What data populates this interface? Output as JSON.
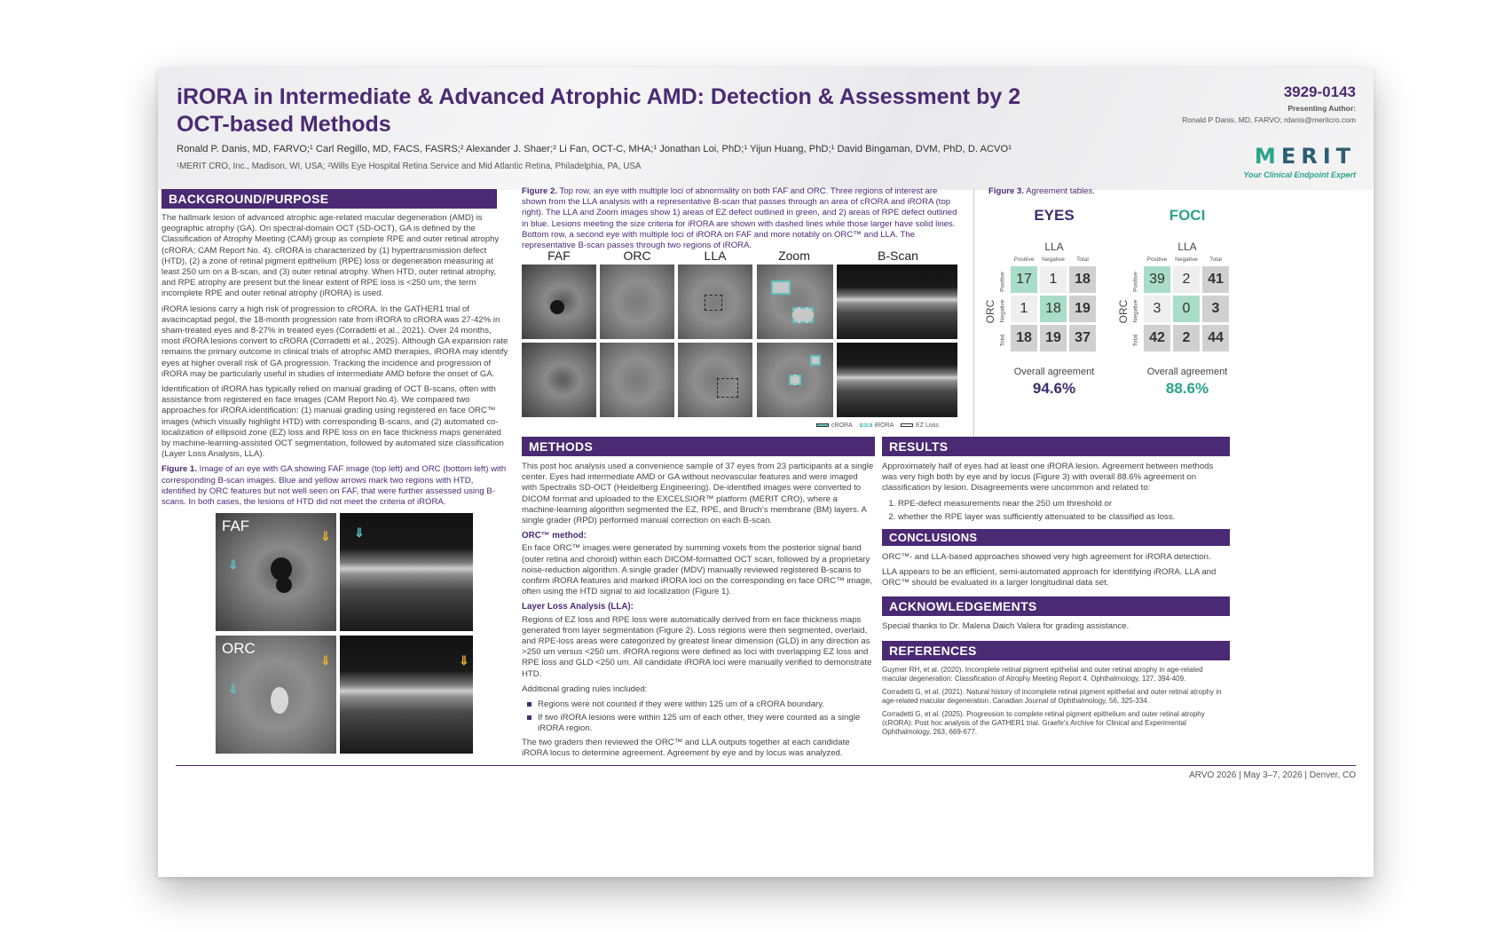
{
  "header": {
    "title": "iRORA in Intermediate & Advanced Atrophic AMD: Detection & Assessment by 2 OCT-based Methods",
    "authors": "Ronald P. Danis, MD, FARVO;¹ Carl Regillo, MD, FACS, FASRS;² Alexander J. Shaer;² Li Fan, OCT-C, MHA;¹ Jonathan Loi, PhD;¹ Yijun Huang, PhD;¹ David Bingaman, DVM, PhD, D. ACVO¹",
    "affiliations": "¹MERIT CRO, Inc., Madison, WI, USA; ²Wills Eye Hospital Retina Service and Mid Atlantic Retina, Philadelphia, PA, USA",
    "poster_id": "3929-0143",
    "presenting_label": "Presenting Author:",
    "presenting_name": "Ronald P Danis, MD, FARVO; rdanis@meritcro.com",
    "logo_text": "MERIT",
    "logo_tagline": "Your Clinical Endpoint Expert"
  },
  "background": {
    "heading": "BACKGROUND/PURPOSE",
    "p1": "The hallmark lesion of advanced atrophic age-related macular degeneration (AMD) is geographic atrophy (GA). On spectral-domain OCT (SD-OCT), GA is defined by the Classification of Atrophy Meeting (CAM) group as complete RPE and outer retinal atrophy (cRORA; CAM Report No. 4). cRORA is characterized by (1) hypertransmission defect (HTD), (2) a zone of retinal pigment epithelium (RPE) loss or degeneration measuring at least 250 um on a B-scan, and (3) outer retinal atrophy. When HTD, outer retinal atrophy, and RPE atrophy are present but the linear extent of RPE loss is <250 um, the term incomplete RPE and outer retinal atrophy (iRORA) is used.",
    "p2": "iRORA lesions carry a high risk of progression to cRORA. In the GATHER1 trial of avacincaptad pegol, the 18-month progression rate from iRORA to cRORA was 27-42% in sham-treated eyes and 8-27% in treated eyes (Corradetti et al., 2021). Over 24 months, most iRORA lesions convert to cRORA (Corradetti et al., 2025). Although GA expansion rate remains the primary outcome in clinical trials of atrophic AMD therapies, iRORA may identify eyes at higher overall risk of GA progression. Tracking the incidence and progression of iRORA may be particularly useful in studies of intermediate AMD before the onset of GA.",
    "p3": "Identification of iRORA has typically relied on manual grading of OCT B-scans, often with assistance from registered en face images (CAM Report No.4). We compared two approaches for iRORA identification: (1) manual grading using registered en face ORC™ images (which visually highlight HTD) with corresponding B-scans, and (2) automated co-localization of ellipsoid zone (EZ) loss and RPE loss on en face thickness maps generated by machine-learning-assisted OCT segmentation, followed by automated size classification (Layer Loss Analysis, LLA).",
    "fig1_label": "Figure 1.",
    "fig1_caption": " Image of an eye with GA showing FAF image (top left) and ORC (bottom left) with corresponding B-scan images. Blue and yellow arrows mark two regions with HTD, identified by ORC features but not well seen on FAF, that were further assessed using B-scans. In both cases, the lesions of HTD did not meet the criteria of iRORA.",
    "fig1_img1_label": "FAF",
    "fig1_img2_label": "ORC"
  },
  "figure2": {
    "label": "Figure 2.",
    "caption": " Top row, an eye with multiple loci of abnormality on both FAF and ORC.  Three regions of interest are shown from the LLA analysis with a representative B-scan that passes through an area of cRORA and iRORA (top right). The LLA and Zoom images show 1) areas of EZ defect outlined in green, and 2) areas of RPE defect outlined in blue. Lesions meeting the size criteria for iRORA are shown with dashed lines while those larger have solid lines. Bottom row, a second eye with multiple loci of iRORA on FAF and more notably on ORC™ and LLA. The representative B-scan passes through two regions of iRORA.",
    "columns": [
      "FAF",
      "ORC",
      "LLA",
      "Zoom",
      "B-Scan"
    ],
    "legend": [
      "cRORA",
      "iRORA",
      "EZ Loss"
    ]
  },
  "figure3": {
    "label": "Figure 3.",
    "caption": " Agreement tables.",
    "row_labels": [
      "Positive",
      "Negative",
      "Total"
    ],
    "col_labels": [
      "Positive",
      "Negative",
      "Total"
    ],
    "axis_top": "LLA",
    "axis_side": "ORC",
    "overall_label": "Overall agreement",
    "eyes": {
      "title": "EYES",
      "color": "#3b2e6e",
      "cells": [
        [
          "17",
          "1",
          "18"
        ],
        [
          "1",
          "18",
          "19"
        ],
        [
          "18",
          "19",
          "37"
        ]
      ],
      "agreement": "94.6%"
    },
    "foci": {
      "title": "FOCI",
      "color": "#2aa48a",
      "cells": [
        [
          "39",
          "2",
          "41"
        ],
        [
          "3",
          "0",
          "3"
        ],
        [
          "42",
          "2",
          "44"
        ]
      ],
      "agreement": "88.6%"
    }
  },
  "methods": {
    "heading": "METHODS",
    "p1": "This post hoc analysis used a convenience sample of 37 eyes from 23 participants at a single center. Eyes had intermediate AMD or GA without neovascular features and were imaged with Spectralis SD-OCT (Heidelberg Engineering). De-identified images were converted to DICOM format and uploaded to the EXCELSIOR™ platform (MERIT CRO), where a machine-learning algorithm segmented the EZ, RPE, and Bruch's membrane (BM) layers. A single grader (RPD) performed manual correction on each B-scan.",
    "orc_heading": "ORC™ method:",
    "orc_text": "En face ORC™ images were generated by summing voxels from the posterior signal band (outer retina and choroid) within each DICOM-formatted OCT scan, followed by a proprietary noise-reduction algorithm. A single grader (MDV) manually reviewed registered B-scans to confirm iRORA features and marked iRORA loci on the corresponding en face ORC™ image, often using the HTD signal to aid localization (Figure 1).",
    "lla_heading": "Layer Loss Analysis (LLA):",
    "lla_text": "Regions of EZ loss and RPE loss were automatically derived from en face thickness maps generated from layer segmentation (Figure 2). Loss regions were then segmented, overlaid, and RPE-loss areas were categorized by greatest linear dimension (GLD) in any direction as >250 um versus <250 um. iRORA regions were defined as loci with overlapping EZ loss and RPE loss and GLD <250 um. All candidate iRORA loci were manually verified to demonstrate HTD.",
    "rules_intro": "Additional grading rules included:",
    "rules": [
      "Regions were not counted if they were within 125 um of a cRORA boundary.",
      "If two iRORA lesions were within 125 um of each other, they were counted as a single iRORA region."
    ],
    "closing": "The two graders then reviewed the ORC™ and LLA outputs together at each candidate iRORA locus to determine agreement. Agreement by eye and by locus was analyzed."
  },
  "results": {
    "heading": "RESULTS",
    "text": "Approximately half of eyes had at least one iRORA lesion. Agreement between methods was very high both by eye and by locus (Figure 3) with overall 88.6% agreement on classification by lesion. Disagreements were uncommon and related to:",
    "items": [
      "RPE-defect measurements near the 250 um threshold or",
      "whether the RPE layer was sufficiently attenuated to be classified as loss."
    ]
  },
  "conclusions": {
    "heading": "CONCLUSIONS",
    "p1": "ORC™- and LLA-based approaches showed very high agreement for iRORA detection.",
    "p2": "LLA appears to be an efficient, semi-automated approach for identifying iRORA. LLA and ORC™ should be evaluated in a larger longitudinal data set."
  },
  "acknowledgements": {
    "heading": "ACKNOWLEDGEMENTS",
    "text": "Special thanks to Dr. Malena Daich Valera for grading assistance."
  },
  "references": {
    "heading": "REFERENCES",
    "items": [
      "Guymer RH, et al. (2020). Incomplete retinal pigment epithelial and outer retinal atrophy in age-related macular degeneration: Classification of Atrophy Meeting Report 4. Ophthalmology, 127, 394-409.",
      "Corradetti G, et al. (2021). Natural history of incomplete retinal pigment epithelial and outer retinal atrophy in age-related macular degeneration. Canadian Journal of Ophthalmology, 56, 325-334.",
      "Corradetti G, et al. (2025). Progression to complete retinal pigment epithelium and outer retinal atrophy (cRORA): Post hoc analysis of the GATHER1 trial. Graefe's Archive for Clinical and Experimental Ophthalmology, 263, 669-677."
    ]
  },
  "footer": "ARVO 2026  |  May 3–7, 2026  |  Denver, CO"
}
